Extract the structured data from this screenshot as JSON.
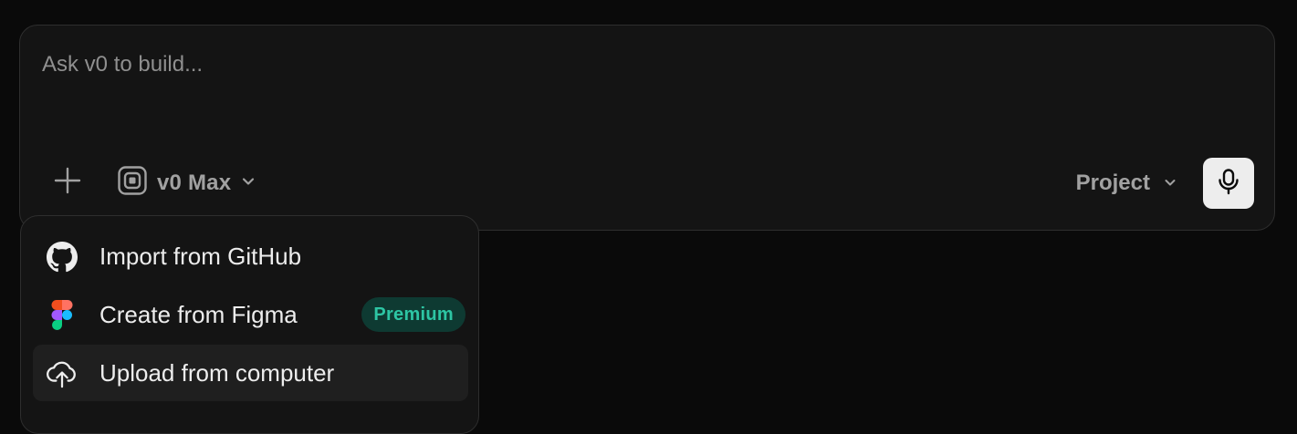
{
  "prompt": {
    "placeholder": "Ask v0 to build..."
  },
  "toolbar": {
    "add_icon": "plus-icon",
    "model": {
      "label": "v0 Max",
      "icon": "model-chip-icon"
    },
    "project": {
      "label": "Project"
    },
    "mic_icon": "microphone-icon"
  },
  "menu": {
    "items": [
      {
        "label": "Import from GitHub",
        "icon": "github-icon"
      },
      {
        "label": "Create from Figma",
        "icon": "figma-icon",
        "badge": "Premium"
      },
      {
        "label": "Upload from computer",
        "icon": "cloud-upload-icon"
      }
    ]
  },
  "colors": {
    "background": "#0a0a0a",
    "panel": "#141414",
    "border": "#2e2e2e",
    "premium_bg": "#0e3a32",
    "premium_text": "#2dc5a4",
    "mic_bg": "#ededed"
  }
}
